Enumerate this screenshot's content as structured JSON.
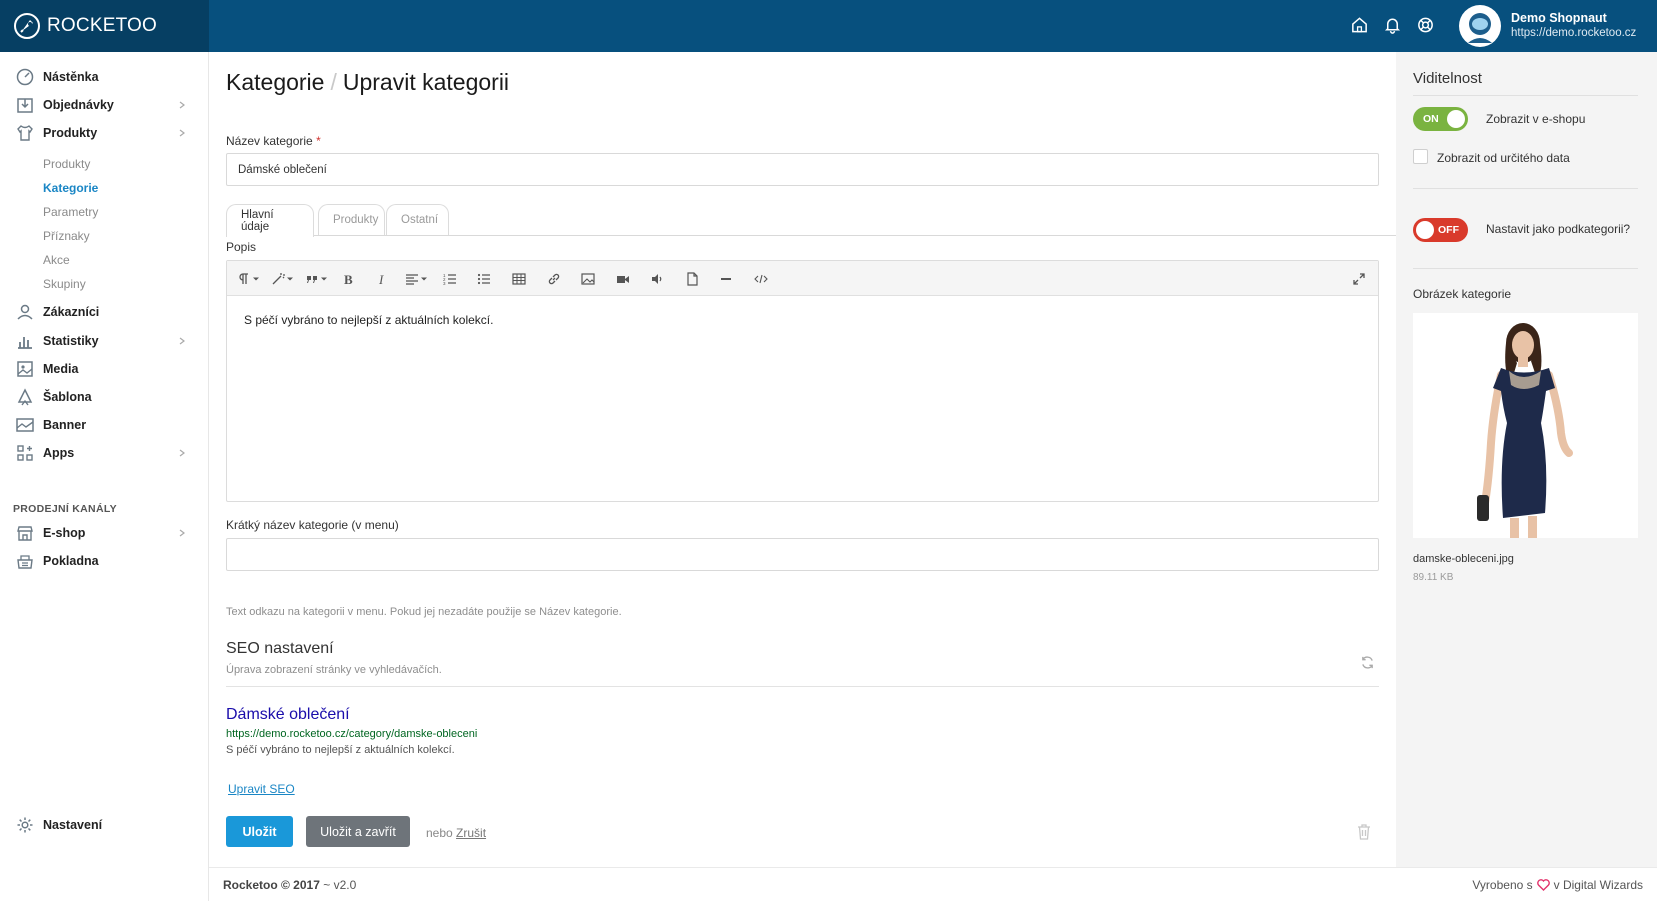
{
  "brand": {
    "name": "ROCKETOO"
  },
  "header": {
    "icons": [
      "home-icon",
      "bell-icon",
      "support-icon"
    ],
    "user": {
      "name": "Demo Shopnaut",
      "url": "https://demo.rocketoo.cz"
    }
  },
  "sidebar": {
    "items": [
      {
        "label": "Nástěnka",
        "icon": "dashboard-icon"
      },
      {
        "label": "Objednávky",
        "icon": "orders-icon"
      },
      {
        "label": "Produkty",
        "icon": "shirt-icon"
      },
      {
        "label": "Zákazníci",
        "icon": "user-icon"
      },
      {
        "label": "Statistiky",
        "icon": "chart-icon"
      },
      {
        "label": "Media",
        "icon": "media-icon"
      },
      {
        "label": "Šablona",
        "icon": "template-icon"
      },
      {
        "label": "Banner",
        "icon": "banner-icon"
      },
      {
        "label": "Apps",
        "icon": "apps-icon"
      }
    ],
    "products_sub": [
      "Produkty",
      "Kategorie",
      "Parametry",
      "Příznaky",
      "Akce",
      "Skupiny"
    ],
    "sales_heading": "PRODEJNÍ KANÁLY",
    "sales_items": [
      {
        "label": "E-shop",
        "icon": "shop-icon"
      },
      {
        "label": "Pokladna",
        "icon": "register-icon"
      }
    ],
    "settings": {
      "label": "Nastavení",
      "icon": "gear-icon"
    }
  },
  "page": {
    "breadcrumb_root": "Kategorie",
    "breadcrumb_sep": "/",
    "title": "Upravit kategorii"
  },
  "form": {
    "name_label": "Název kategorie",
    "required_mark": "*",
    "name_value": "Dámské oblečení",
    "tabs": [
      "Hlavní údaje",
      "Produkty",
      "Ostatní"
    ],
    "active_tab": "Hlavní údaje",
    "description_label": "Popis",
    "description_text": "S péčí vybráno to nejlepší z aktuálních kolekcí.",
    "short_name_label": "Krátký název kategorie (v menu)",
    "short_name_value": "",
    "short_name_help": "Text odkazu na kategorii v menu. Pokud jej nezadáte použije se Název kategorie."
  },
  "seo": {
    "title": "SEO nastavení",
    "subtitle": "Úprava zobrazení stránky ve vyhledávačích.",
    "preview_title": "Dámské oblečení",
    "preview_url": "https://demo.rocketoo.cz/category/damske-obleceni",
    "preview_desc": "S péčí vybráno to nejlepší z aktuálních kolekcí.",
    "edit_link": "Upravit SEO"
  },
  "actions": {
    "save": "Uložit",
    "save_close": "Uložit a zavřít",
    "or": "nebo",
    "cancel": "Zrušit"
  },
  "visibility": {
    "title": "Viditelnost",
    "show_toggle": "ON",
    "show_label": "Zobrazit v e-shopu",
    "date_label": "Zobrazit od určitého data",
    "sub_toggle": "OFF",
    "sub_label": "Nastavit jako podkategorii?",
    "image_label": "Obrázek kategorie",
    "file_name": "damske-obleceni.jpg",
    "file_size": "89.11 KB"
  },
  "footer": {
    "brand": "Rocketoo © 2017",
    "version": "~ v2.0",
    "made_prefix": "Vyrobeno s",
    "made_suffix": "v Digital Wizards"
  },
  "colors": {
    "topbar": "#07507e",
    "accent": "#1a98d9",
    "toggle_on": "#7ab340",
    "toggle_off": "#d93a2b"
  }
}
